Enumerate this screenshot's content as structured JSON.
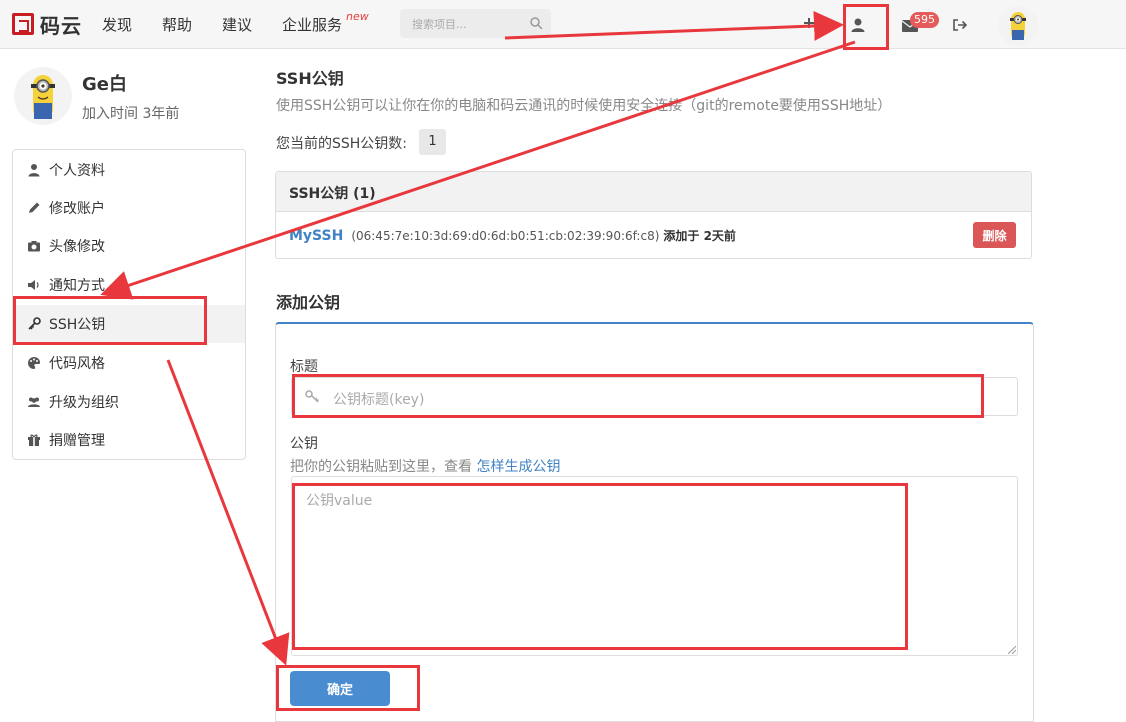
{
  "header": {
    "brand": "码云",
    "nav": [
      "发现",
      "帮助",
      "建议",
      "企业服务"
    ],
    "nav_new_badge": "new",
    "search_placeholder": "搜索项目...",
    "mail_count": "595"
  },
  "profile": {
    "name": "Ge白",
    "joined": "加入时间 3年前"
  },
  "sidebar": {
    "items": [
      {
        "label": "个人资料",
        "icon": "user-icon"
      },
      {
        "label": "修改账户",
        "icon": "pencil-icon"
      },
      {
        "label": "头像修改",
        "icon": "camera-icon"
      },
      {
        "label": "通知方式",
        "icon": "volume-icon"
      },
      {
        "label": "SSH公钥",
        "icon": "key-icon",
        "active": true
      },
      {
        "label": "代码风格",
        "icon": "palette-icon"
      },
      {
        "label": "升级为组织",
        "icon": "users-icon"
      },
      {
        "label": "捐赠管理",
        "icon": "gift-icon"
      }
    ]
  },
  "main": {
    "title": "SSH公钥",
    "description": "使用SSH公钥可以让你在你的电脑和码云通讯的时候使用安全连接（git的remote要使用SSH地址）",
    "count_label": "您当前的SSH公钥数:",
    "count": "1",
    "keys_header": "SSH公钥 (1)",
    "keys": [
      {
        "name": "MySSH",
        "fingerprint": "(06:45:7e:10:3d:69:d0:6d:b0:51:cb:02:39:90:6f:c8)",
        "added": "添加于 2天前",
        "delete_label": "删除"
      }
    ],
    "add_title": "添加公钥",
    "form": {
      "title_label": "标题",
      "title_placeholder": "公钥标题(key)",
      "key_label": "公钥",
      "help_text": "把你的公钥粘贴到这里，查看",
      "help_link": "怎样生成公钥",
      "key_placeholder": "公钥value",
      "submit_label": "确定"
    }
  },
  "colors": {
    "brand_red": "#c71d23",
    "link_blue": "#4183c4",
    "button_blue": "#4a8cd0",
    "danger_red": "#db5656",
    "annotation_red": "#e8383d"
  }
}
